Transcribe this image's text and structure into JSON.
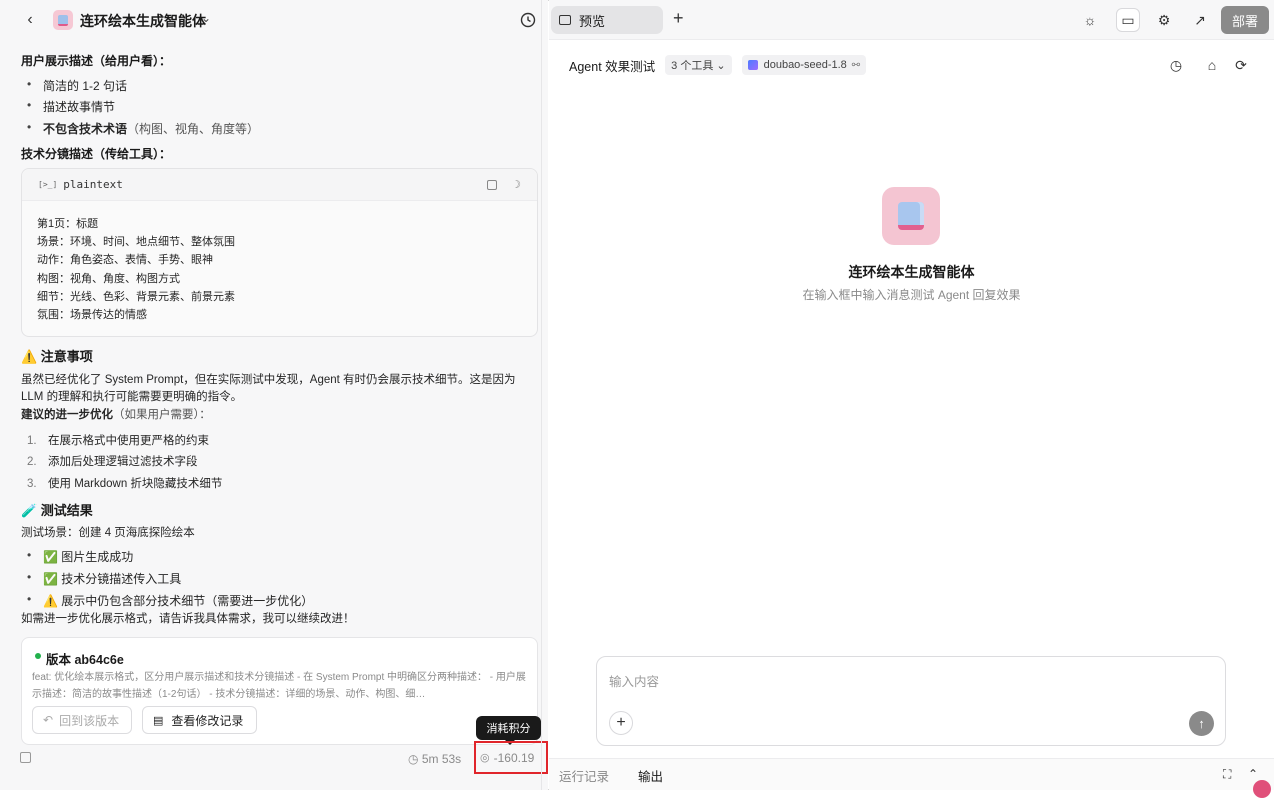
{
  "left": {
    "title": "连环绘本生成智能体",
    "user_desc_label": "用户展示描述（给用户看）：",
    "user_desc_items": [
      "简洁的 1-2 句话",
      "描述故事情节"
    ],
    "user_desc_item3_bold": "不包含技术术语",
    "user_desc_item3_rest": "（构图、视角、角度等）",
    "tech_desc_label": "技术分镜描述（传给工具）：",
    "code": {
      "lang_icon": "[>_]",
      "lang": "plaintext",
      "lines": [
        "第1页：标题",
        "场景：环境、时间、地点细节、整体氛围",
        "动作：角色姿态、表情、手势、眼神",
        "构图：视角、角度、构图方式",
        "细节：光线、色彩、背景元素、前景元素",
        "氛围：场景传达的情感"
      ]
    },
    "notice_title": "⚠️ 注意事项",
    "notice_para1": "虽然已经优化了 System Prompt，但在实际测试中发现，Agent 有时仍会展示技术细节。这是因为",
    "notice_para2": "LLM 的理解和执行可能需要更明确的指令。",
    "suggest_bold": "建议的进一步优化",
    "suggest_rest": "（如果用户需要）：",
    "suggest_items": [
      {
        "n": "1.",
        "text": "在展示格式中使用更严格的约束"
      },
      {
        "n": "2.",
        "text": "添加后处理逻辑过滤技术字段"
      },
      {
        "n": "3.",
        "text": "使用 Markdown 折块隐藏技术细节"
      }
    ],
    "test_title": "🧪 测试结果",
    "test_scene": "测试场景：创建 4 页海底探险绘本",
    "test_items": [
      "✅ 图片生成成功",
      "✅ 技术分镜描述传入工具",
      "⚠️ 展示中仍包含部分技术细节（需要进一步优化）"
    ],
    "closing": "如需进一步优化展示格式，请告诉我具体需求，我可以继续改进！",
    "version": {
      "title": "版本 ab64c6e",
      "desc": "feat: 优化绘本展示格式，区分用户展示描述和技术分镜描述 - 在 System Prompt 中明确区分两种描述： - 用户展示描述：简洁的故事性描述（1-2句话） - 技术分镜描述：详细的场景、动作、构图、细…",
      "revert_label": "回到该版本",
      "changes_label": "查看修改记录"
    },
    "tooltip": "消耗积分",
    "duration": "5m 53s",
    "credits": "-160.19"
  },
  "right": {
    "tab_label": "预览",
    "deploy_label": "部署",
    "agent_label": "Agent 效果测试",
    "tools_chip": "3 个工具 ⌄",
    "model_chip": "doubao-seed-1.8",
    "hero_title": "连环绘本生成智能体",
    "hero_sub": "在输入框中输入消息测试 Agent 回复效果",
    "input_placeholder": "输入内容",
    "tab_run_log": "运行记录",
    "tab_output": "输出"
  }
}
